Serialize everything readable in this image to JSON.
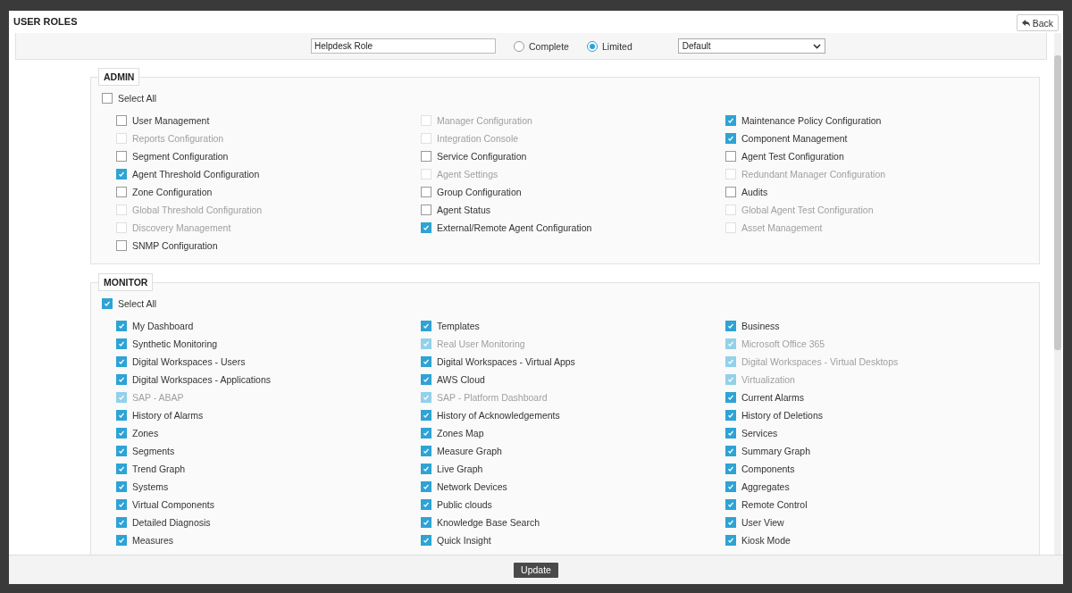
{
  "title": "USER ROLES",
  "back_button": {
    "label": "Back"
  },
  "toolbar": {
    "role_name": {
      "value": "Helpdesk Role"
    },
    "access": [
      {
        "label": "Complete",
        "selected": false
      },
      {
        "label": "Limited",
        "selected": true
      }
    ],
    "dropdown": {
      "value": "Default"
    }
  },
  "sections": [
    {
      "title": "ADMIN",
      "select_all": {
        "label": "Select All",
        "checked": false
      },
      "columns": [
        {
          "items": [
            {
              "label": "User Management",
              "checked": false,
              "disabled": false
            },
            {
              "label": "Reports Configuration",
              "checked": false,
              "disabled": true
            },
            {
              "label": "Segment Configuration",
              "checked": false,
              "disabled": false
            },
            {
              "label": "Agent Threshold Configuration",
              "checked": true,
              "disabled": false
            },
            {
              "label": "Zone Configuration",
              "checked": false,
              "disabled": false
            },
            {
              "label": "Global Threshold Configuration",
              "checked": false,
              "disabled": true
            },
            {
              "label": "Discovery Management",
              "checked": false,
              "disabled": true
            },
            {
              "label": "SNMP Configuration",
              "checked": false,
              "disabled": false
            }
          ]
        },
        {
          "items": [
            {
              "label": "Manager Configuration",
              "checked": false,
              "disabled": true
            },
            {
              "label": "Integration Console",
              "checked": false,
              "disabled": true
            },
            {
              "label": "Service Configuration",
              "checked": false,
              "disabled": false
            },
            {
              "label": "Agent Settings",
              "checked": false,
              "disabled": true
            },
            {
              "label": "Group Configuration",
              "checked": false,
              "disabled": false
            },
            {
              "label": "Agent Status",
              "checked": false,
              "disabled": false
            },
            {
              "label": "External/Remote Agent Configuration",
              "checked": true,
              "disabled": false
            }
          ]
        },
        {
          "items": [
            {
              "label": "Maintenance Policy Configuration",
              "checked": true,
              "disabled": false
            },
            {
              "label": "Component Management",
              "checked": true,
              "disabled": false
            },
            {
              "label": "Agent Test Configuration",
              "checked": false,
              "disabled": false
            },
            {
              "label": "Redundant Manager Configuration",
              "checked": false,
              "disabled": true
            },
            {
              "label": "Audits",
              "checked": false,
              "disabled": false
            },
            {
              "label": "Global Agent Test Configuration",
              "checked": false,
              "disabled": true
            },
            {
              "label": "Asset Management",
              "checked": false,
              "disabled": true
            }
          ]
        }
      ]
    },
    {
      "title": "MONITOR",
      "select_all": {
        "label": "Select All",
        "checked": true
      },
      "columns": [
        {
          "items": [
            {
              "label": "My Dashboard",
              "checked": true,
              "disabled": false
            },
            {
              "label": "Synthetic Monitoring",
              "checked": true,
              "disabled": false
            },
            {
              "label": "Digital Workspaces - Users",
              "checked": true,
              "disabled": false
            },
            {
              "label": "Digital Workspaces - Applications",
              "checked": true,
              "disabled": false
            },
            {
              "label": "SAP - ABAP",
              "checked": true,
              "disabled": true
            },
            {
              "label": "History of Alarms",
              "checked": true,
              "disabled": false
            },
            {
              "label": "Zones",
              "checked": true,
              "disabled": false
            },
            {
              "label": "Segments",
              "checked": true,
              "disabled": false
            },
            {
              "label": "Trend Graph",
              "checked": true,
              "disabled": false
            },
            {
              "label": "Systems",
              "checked": true,
              "disabled": false
            },
            {
              "label": "Virtual Components",
              "checked": true,
              "disabled": false
            },
            {
              "label": "Detailed Diagnosis",
              "checked": true,
              "disabled": false
            },
            {
              "label": "Measures",
              "checked": true,
              "disabled": false
            }
          ]
        },
        {
          "items": [
            {
              "label": "Templates",
              "checked": true,
              "disabled": false
            },
            {
              "label": "Real User Monitoring",
              "checked": true,
              "disabled": true
            },
            {
              "label": "Digital Workspaces - Virtual Apps",
              "checked": true,
              "disabled": false
            },
            {
              "label": "AWS Cloud",
              "checked": true,
              "disabled": false
            },
            {
              "label": "SAP - Platform Dashboard",
              "checked": true,
              "disabled": true
            },
            {
              "label": "History of Acknowledgements",
              "checked": true,
              "disabled": false
            },
            {
              "label": "Zones Map",
              "checked": true,
              "disabled": false
            },
            {
              "label": "Measure Graph",
              "checked": true,
              "disabled": false
            },
            {
              "label": "Live Graph",
              "checked": true,
              "disabled": false
            },
            {
              "label": "Network Devices",
              "checked": true,
              "disabled": false
            },
            {
              "label": "Public clouds",
              "checked": true,
              "disabled": false
            },
            {
              "label": "Knowledge Base Search",
              "checked": true,
              "disabled": false
            },
            {
              "label": "Quick Insight",
              "checked": true,
              "disabled": false
            }
          ]
        },
        {
          "items": [
            {
              "label": "Business",
              "checked": true,
              "disabled": false
            },
            {
              "label": "Microsoft Office 365",
              "checked": true,
              "disabled": true
            },
            {
              "label": "Digital Workspaces - Virtual Desktops",
              "checked": true,
              "disabled": true
            },
            {
              "label": "Virtualization",
              "checked": true,
              "disabled": true
            },
            {
              "label": "Current Alarms",
              "checked": true,
              "disabled": false
            },
            {
              "label": "History of Deletions",
              "checked": true,
              "disabled": false
            },
            {
              "label": "Services",
              "checked": true,
              "disabled": false
            },
            {
              "label": "Summary Graph",
              "checked": true,
              "disabled": false
            },
            {
              "label": "Components",
              "checked": true,
              "disabled": false
            },
            {
              "label": "Aggregates",
              "checked": true,
              "disabled": false
            },
            {
              "label": "Remote Control",
              "checked": true,
              "disabled": false
            },
            {
              "label": "User View",
              "checked": true,
              "disabled": false
            },
            {
              "label": "Kiosk Mode",
              "checked": true,
              "disabled": false
            }
          ]
        }
      ]
    }
  ],
  "footer": {
    "update_button": {
      "label": "Update"
    }
  }
}
